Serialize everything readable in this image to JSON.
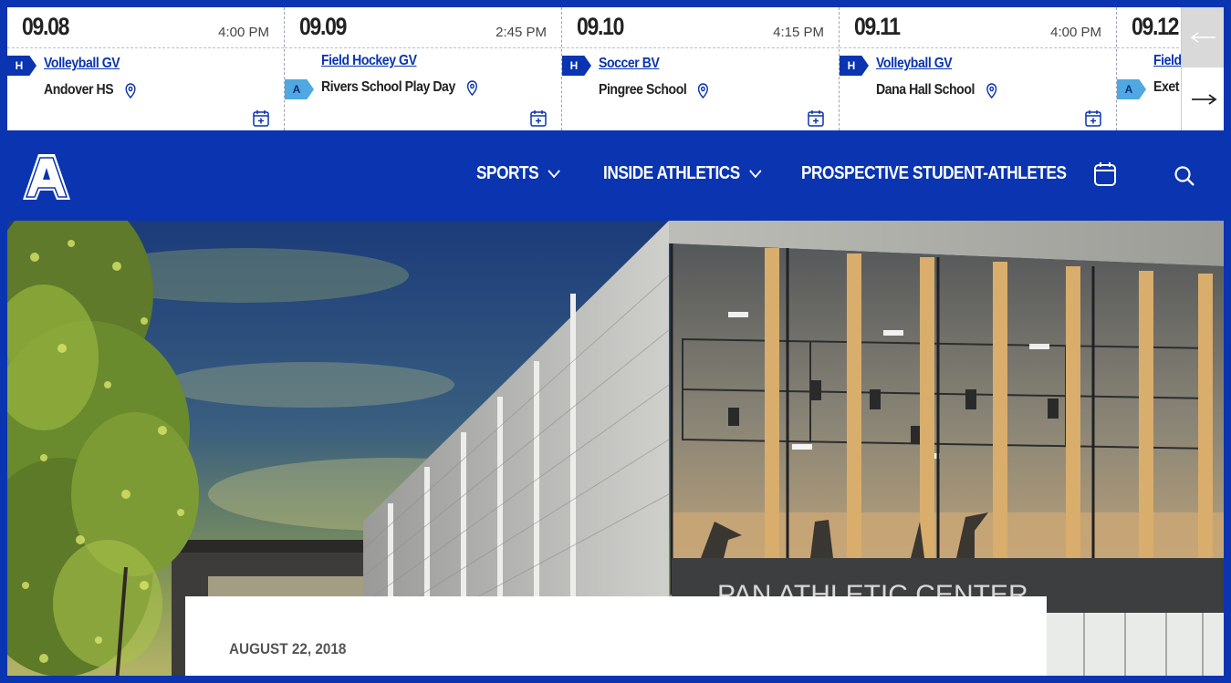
{
  "schedule": {
    "games": [
      {
        "date": "09.08",
        "time": "4:00 PM",
        "location_type": "H",
        "sport": "Volleyball GV",
        "opponent": "Andover HS"
      },
      {
        "date": "09.09",
        "time": "2:45 PM",
        "location_type": "A",
        "sport": "Field Hockey GV",
        "opponent": "Rivers School Play Day"
      },
      {
        "date": "09.10",
        "time": "4:15 PM",
        "location_type": "H",
        "sport": "Soccer BV",
        "opponent": "Pingree School"
      },
      {
        "date": "09.11",
        "time": "4:00 PM",
        "location_type": "H",
        "sport": "Volleyball GV",
        "opponent": "Dana Hall School"
      },
      {
        "date": "09.12",
        "time": "",
        "location_type": "A",
        "sport": "Field",
        "opponent": "Exet"
      }
    ],
    "prev_icon": "arrow-left-icon",
    "next_icon": "arrow-right-icon"
  },
  "nav": {
    "logo_letter": "A",
    "items": [
      {
        "label": "SPORTS",
        "has_dropdown": true
      },
      {
        "label": "INSIDE ATHLETICS",
        "has_dropdown": true
      },
      {
        "label": "PROSPECTIVE STUDENT-ATHLETES",
        "has_dropdown": false
      }
    ],
    "calendar_icon": "calendar-icon",
    "search_icon": "search-icon"
  },
  "hero": {
    "signage": "PAN ATHLETIC CENTER",
    "card_date": "AUGUST 22, 2018"
  },
  "colors": {
    "brand_blue": "#0a34b0",
    "away_blue": "#4fa8e0",
    "text_dark": "#222222"
  }
}
